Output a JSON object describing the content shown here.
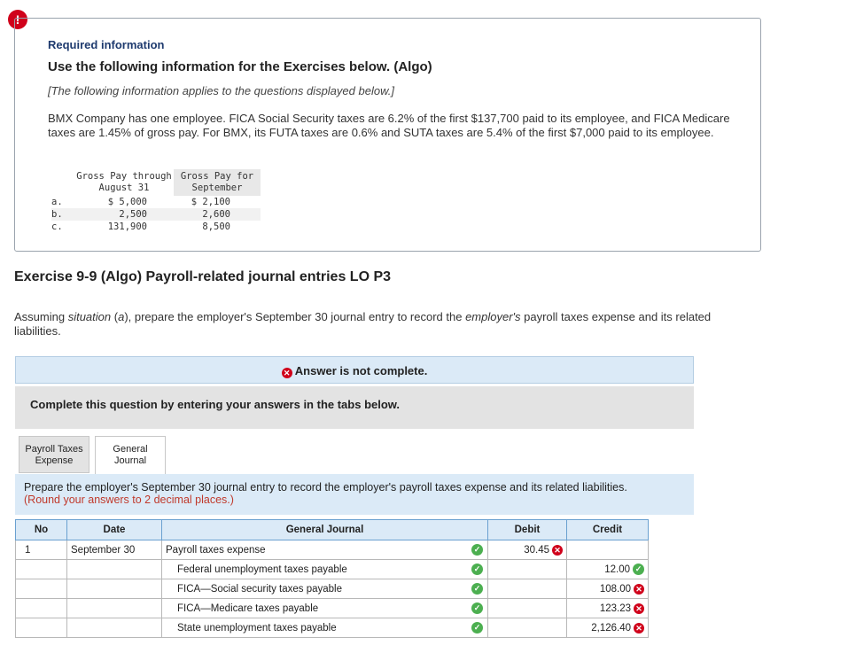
{
  "alert_glyph": "!",
  "info": {
    "required_title": "Required information",
    "use_title": "Use the following information for the Exercises below. (Algo)",
    "note": "[The following information applies to the questions displayed below.]",
    "paragraph": "BMX Company has one employee. FICA Social Security taxes are 6.2% of the first $137,700 paid to its employee, and FICA Medicare taxes are 1.45% of gross pay. For BMX, its FUTA taxes are 0.6% and SUTA taxes are 5.4% of the first $7,000 paid to its employee.",
    "table": {
      "header1": "Gross Pay through August 31",
      "header2": "Gross Pay for September",
      "rows": [
        {
          "label": "a.",
          "through_aug": "$ 5,000",
          "september": "$ 2,100"
        },
        {
          "label": "b.",
          "through_aug": "2,500",
          "september": "2,600"
        },
        {
          "label": "c.",
          "through_aug": "131,900",
          "september": "8,500"
        }
      ]
    }
  },
  "exercise": {
    "title": "Exercise 9-9 (Algo) Payroll-related journal entries LO P3",
    "assume_1": "Assuming ",
    "assume_situation": "situation",
    "assume_2": " (",
    "assume_a": "a",
    "assume_3": "), prepare the employer's September 30 journal entry to record the ",
    "assume_employers": "employer's",
    "assume_4": " payroll taxes expense and its related liabilities."
  },
  "status": {
    "answer_text": "Answer is not complete.",
    "complete_text": "Complete this question by entering your answers in the tabs below."
  },
  "tabs": [
    {
      "label_line1": "Payroll Taxes",
      "label_line2": "Expense"
    },
    {
      "label_line1": "General",
      "label_line2": "Journal"
    }
  ],
  "prepare": {
    "text": "Prepare the employer's September 30 journal entry to record the employer's payroll taxes expense and its related liabilities.",
    "round": "(Round your answers to 2 decimal places.)"
  },
  "journal": {
    "headers": {
      "no": "No",
      "date": "Date",
      "general_journal": "General Journal",
      "debit": "Debit",
      "credit": "Credit"
    },
    "rows": [
      {
        "no": "1",
        "date": "September 30",
        "account": "Payroll taxes expense",
        "debit": "30.45",
        "credit": ""
      },
      {
        "no": "",
        "date": "",
        "account": "Federal unemployment taxes payable",
        "debit": "",
        "credit": "12.00"
      },
      {
        "no": "",
        "date": "",
        "account": "FICA—Social security taxes payable",
        "debit": "",
        "credit": "108.00"
      },
      {
        "no": "",
        "date": "",
        "account": "FICA—Medicare taxes payable",
        "debit": "",
        "credit": "123.23"
      },
      {
        "no": "",
        "date": "",
        "account": "State unemployment taxes payable",
        "debit": "",
        "credit": "2,126.40"
      }
    ]
  },
  "colors": {
    "error": "#d0021b",
    "correct": "#4caf50",
    "header_blue": "#dbeaf7"
  },
  "icons": {
    "error": "x-circle-icon",
    "correct": "check-circle-icon"
  }
}
